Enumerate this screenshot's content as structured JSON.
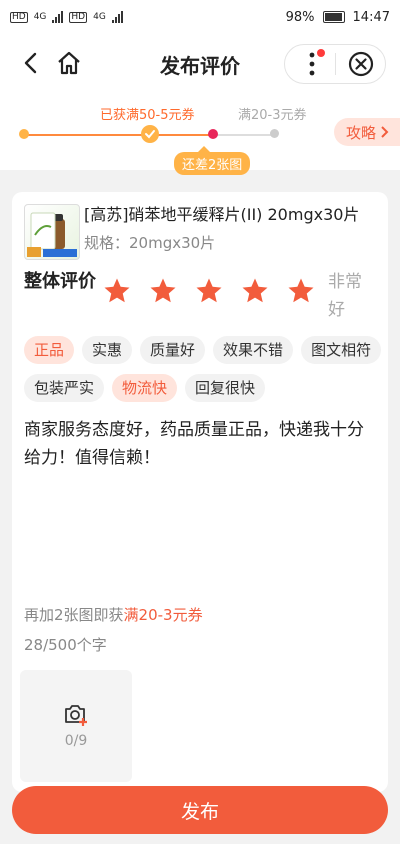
{
  "status_bar": {
    "left": [
      {
        "badge": "HD",
        "net": "4G",
        "bars": 4
      },
      {
        "badge": "HD",
        "net": "4G",
        "bars": 4
      }
    ],
    "battery": "98%",
    "time": "14:47"
  },
  "header": {
    "title": "发布评价",
    "icons": {
      "back": "back-arrow-icon",
      "home": "home-icon",
      "more": "more-dots-icon",
      "close": "close-circle-icon"
    },
    "notify_color": "#ff3b3b"
  },
  "progress": {
    "achieved": "已获满50-5元券",
    "next": "满20-3元券",
    "tip": "还差2张图",
    "strategy": "攻略",
    "accent": "#ff6a2d"
  },
  "product": {
    "name": "[高苏]硝苯地平缓释片(II) 20mgx30片",
    "spec": "规格：20mgx30片"
  },
  "rating": {
    "label": "整体评价",
    "stars": 5,
    "max": 5,
    "star_color": "#f25c3c",
    "desc": "非常好"
  },
  "tags": [
    {
      "label": "正品",
      "selected": true
    },
    {
      "label": "实惠",
      "selected": false
    },
    {
      "label": "质量好",
      "selected": false
    },
    {
      "label": "效果不错",
      "selected": false
    },
    {
      "label": "图文相符",
      "selected": false
    },
    {
      "label": "包装严实",
      "selected": false
    },
    {
      "label": "物流快",
      "selected": true
    },
    {
      "label": "回复很快",
      "selected": false
    }
  ],
  "review": {
    "text": "商家服务态度好，药品质量正品，快递我十分给力！值得信赖！",
    "hint_prefix": "再加2张图即获",
    "hint_reward": "满20-3元券",
    "char_count": "28/500个字"
  },
  "upload": {
    "icon": "camera-add-icon",
    "count": "0/9"
  },
  "publish": {
    "label": "发布",
    "color": "#f25c3c"
  }
}
